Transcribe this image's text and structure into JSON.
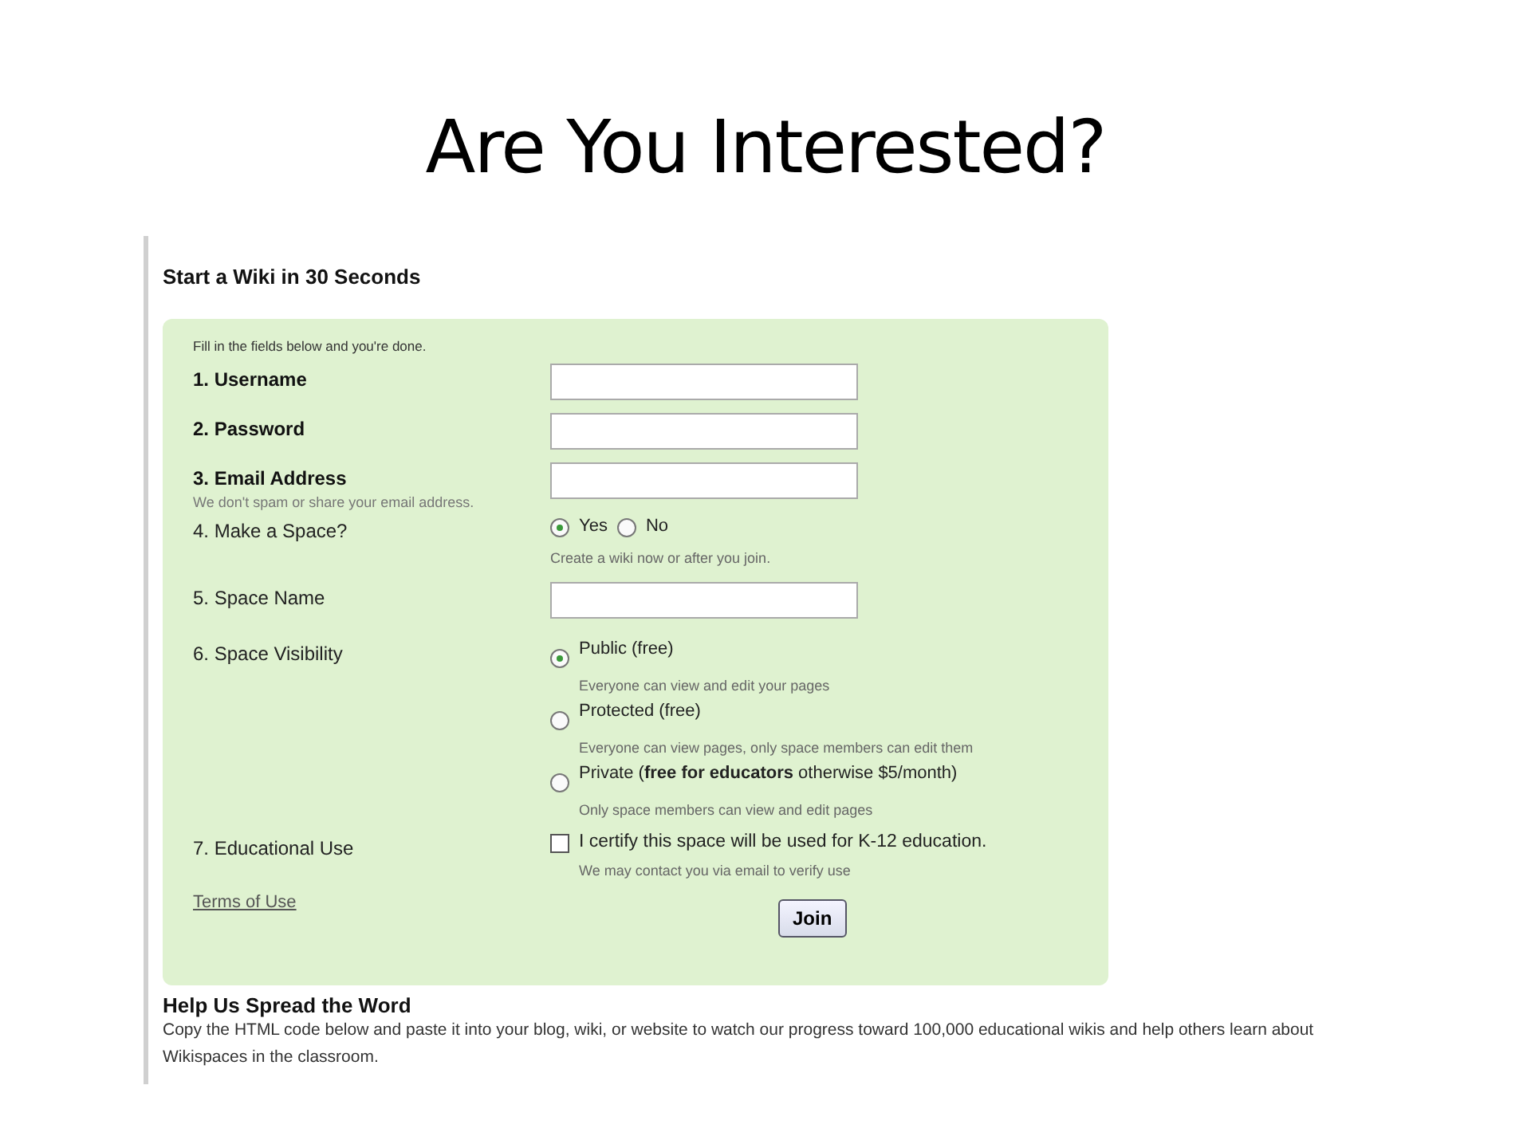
{
  "slide_title": "Are You Interested?",
  "heading": "Start a Wiki in 30 Seconds",
  "form": {
    "intro": "Fill in the fields below and you're done.",
    "rows": [
      {
        "kind": "input",
        "label": "1. Username",
        "bold": true
      },
      {
        "kind": "input",
        "label": "2. Password",
        "bold": true
      },
      {
        "kind": "input",
        "label": "3. Email Address",
        "bold": true,
        "note": "We don't spam or share your email address."
      },
      {
        "kind": "choice_inline",
        "label": "4. Make a Space?",
        "bold": false,
        "options": [
          {
            "label": "Yes",
            "selected": true
          },
          {
            "label": "No",
            "selected": false
          }
        ],
        "help": "Create a wiki now or after you join."
      },
      {
        "kind": "input",
        "label": "5. Space Name",
        "bold": false
      },
      {
        "kind": "choice_list",
        "label": "6. Space Visibility",
        "bold": false,
        "options": [
          {
            "label": "Public (free)",
            "help": "Everyone can view and edit your pages",
            "selected": true
          },
          {
            "label": "Protected (free)",
            "help": "Everyone can view pages, only space members can edit them",
            "selected": false
          },
          {
            "label": "Private (**free for educators** otherwise $5/month)",
            "help": "Only space members can view and edit pages",
            "selected": false
          }
        ]
      },
      {
        "kind": "checkbox",
        "label": "7. Educational Use",
        "bold": false,
        "checked": false,
        "text": "I certify this space will be used for K-12 education.",
        "help": "We may contact you via email to verify use"
      }
    ],
    "terms_link": "Terms of Use",
    "submit": "Join"
  },
  "spread": {
    "title": "Help Us Spread the Word",
    "text": "Copy the HTML code below and paste it into your blog, wiki, or website to watch our progress toward 100,000 educational wikis and help others learn about Wikispaces in the classroom."
  }
}
